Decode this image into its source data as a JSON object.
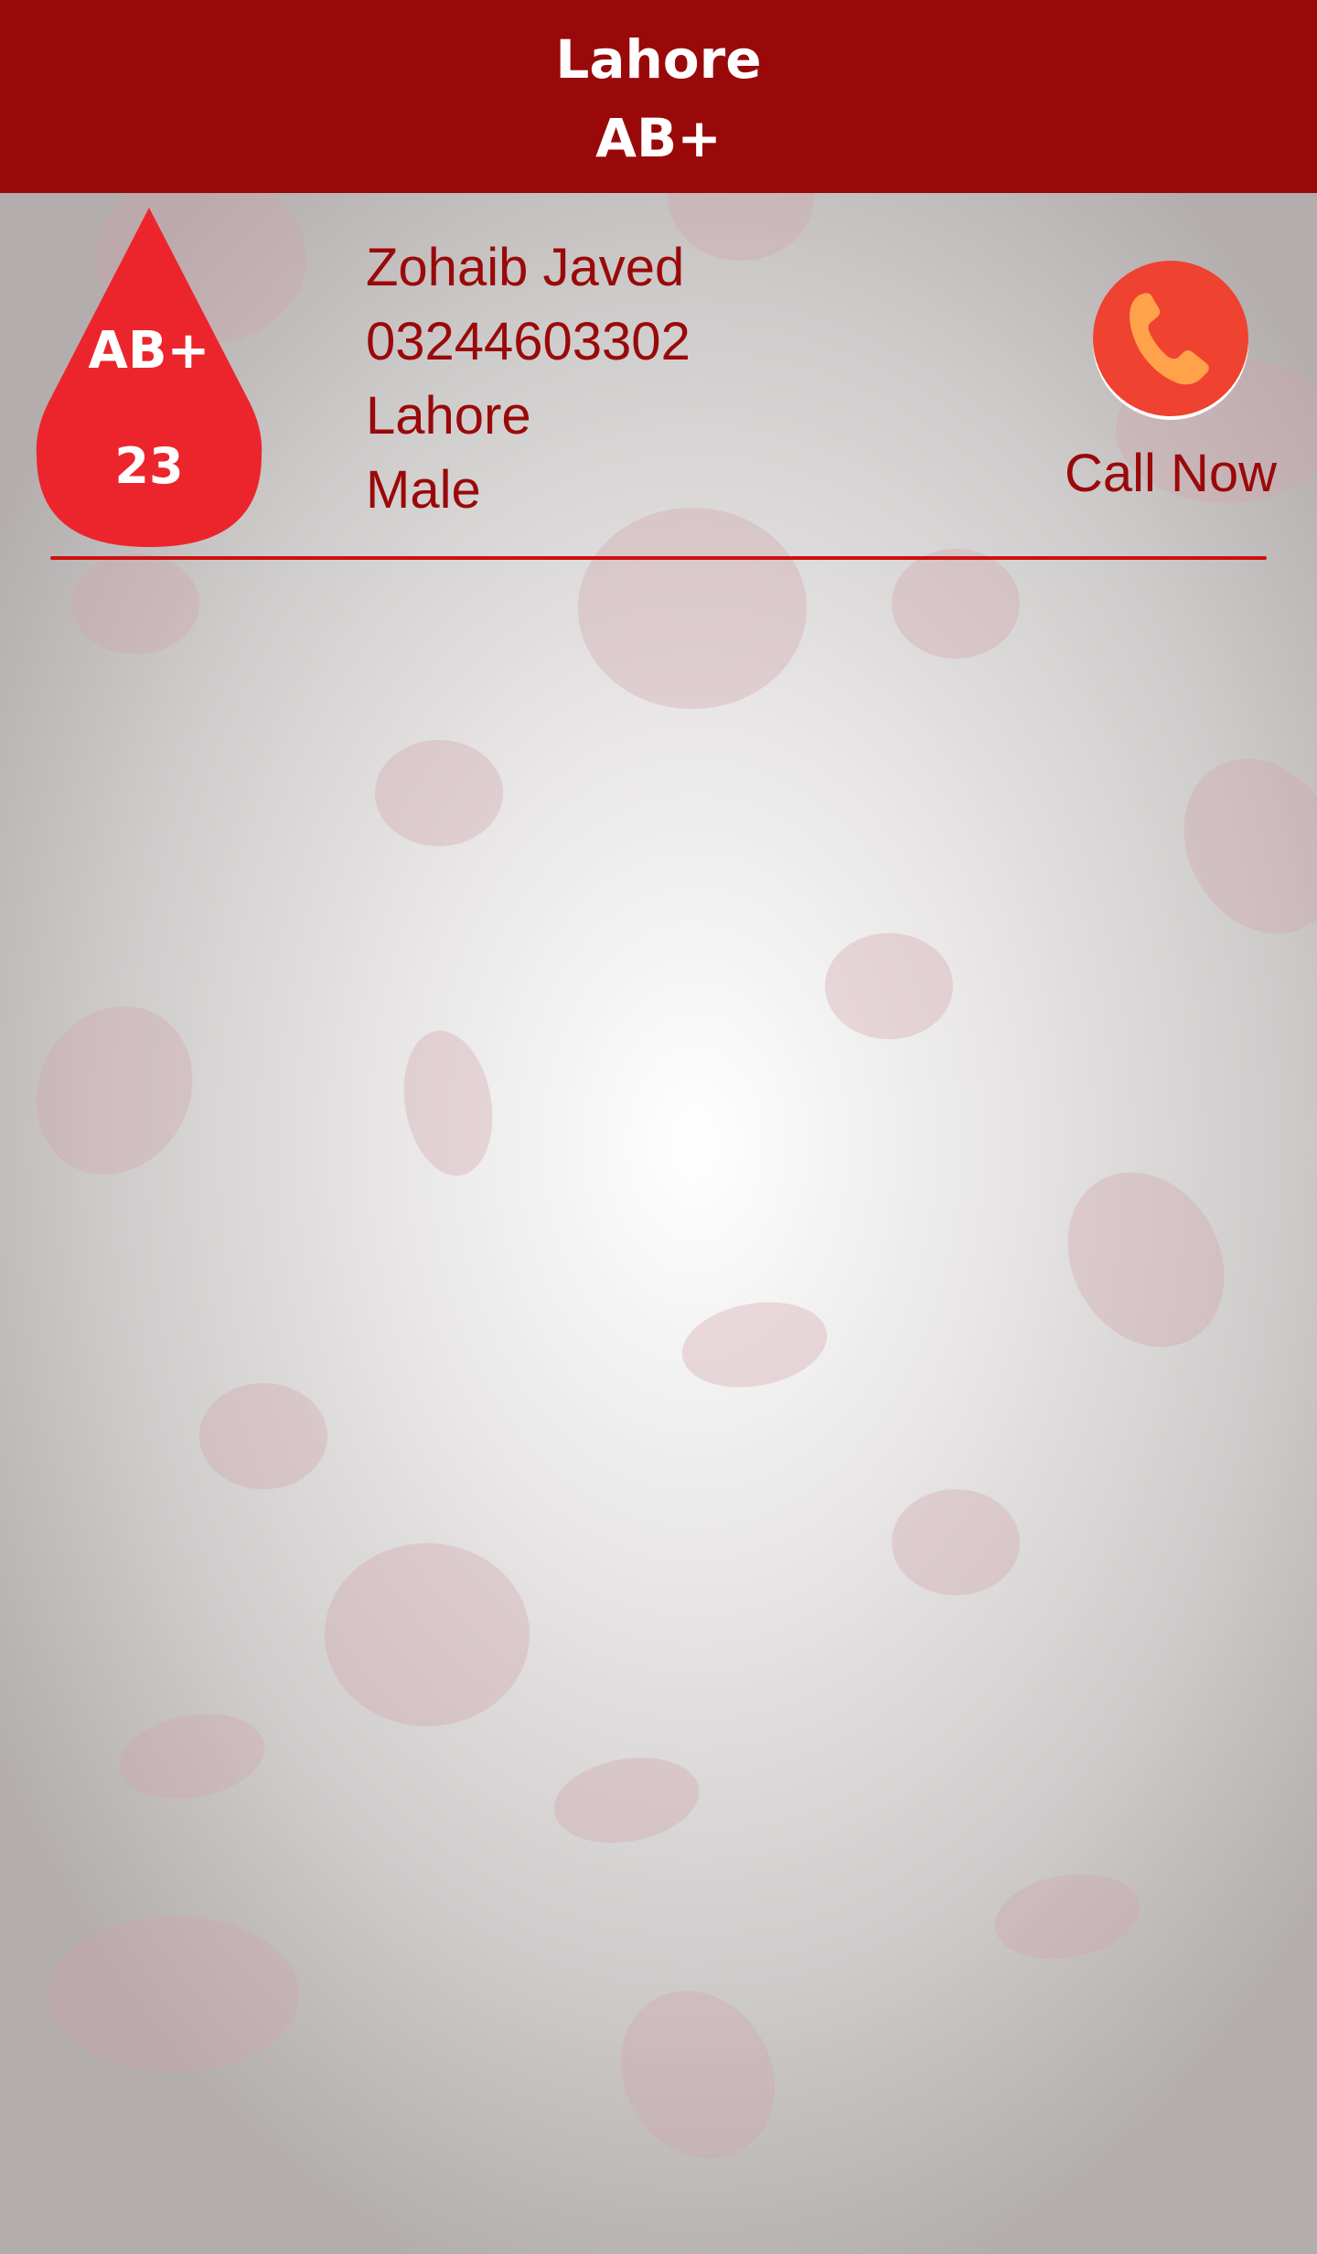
{
  "header": {
    "city": "Lahore",
    "blood_group": "AB+"
  },
  "donor": {
    "blood_group": "AB+",
    "age": "23",
    "name": "Zohaib Javed",
    "phone": "03244603302",
    "city": "Lahore",
    "gender": "Male",
    "call_label": "Call Now",
    "call_icon": "phone-icon"
  },
  "colors": {
    "header_bg": "#9a0909",
    "text_primary": "#9a0909",
    "drop_fill": "#ec252d",
    "call_button_bg": "#ef4231",
    "call_icon_color": "#ffa24a",
    "divider": "#cc1111"
  }
}
